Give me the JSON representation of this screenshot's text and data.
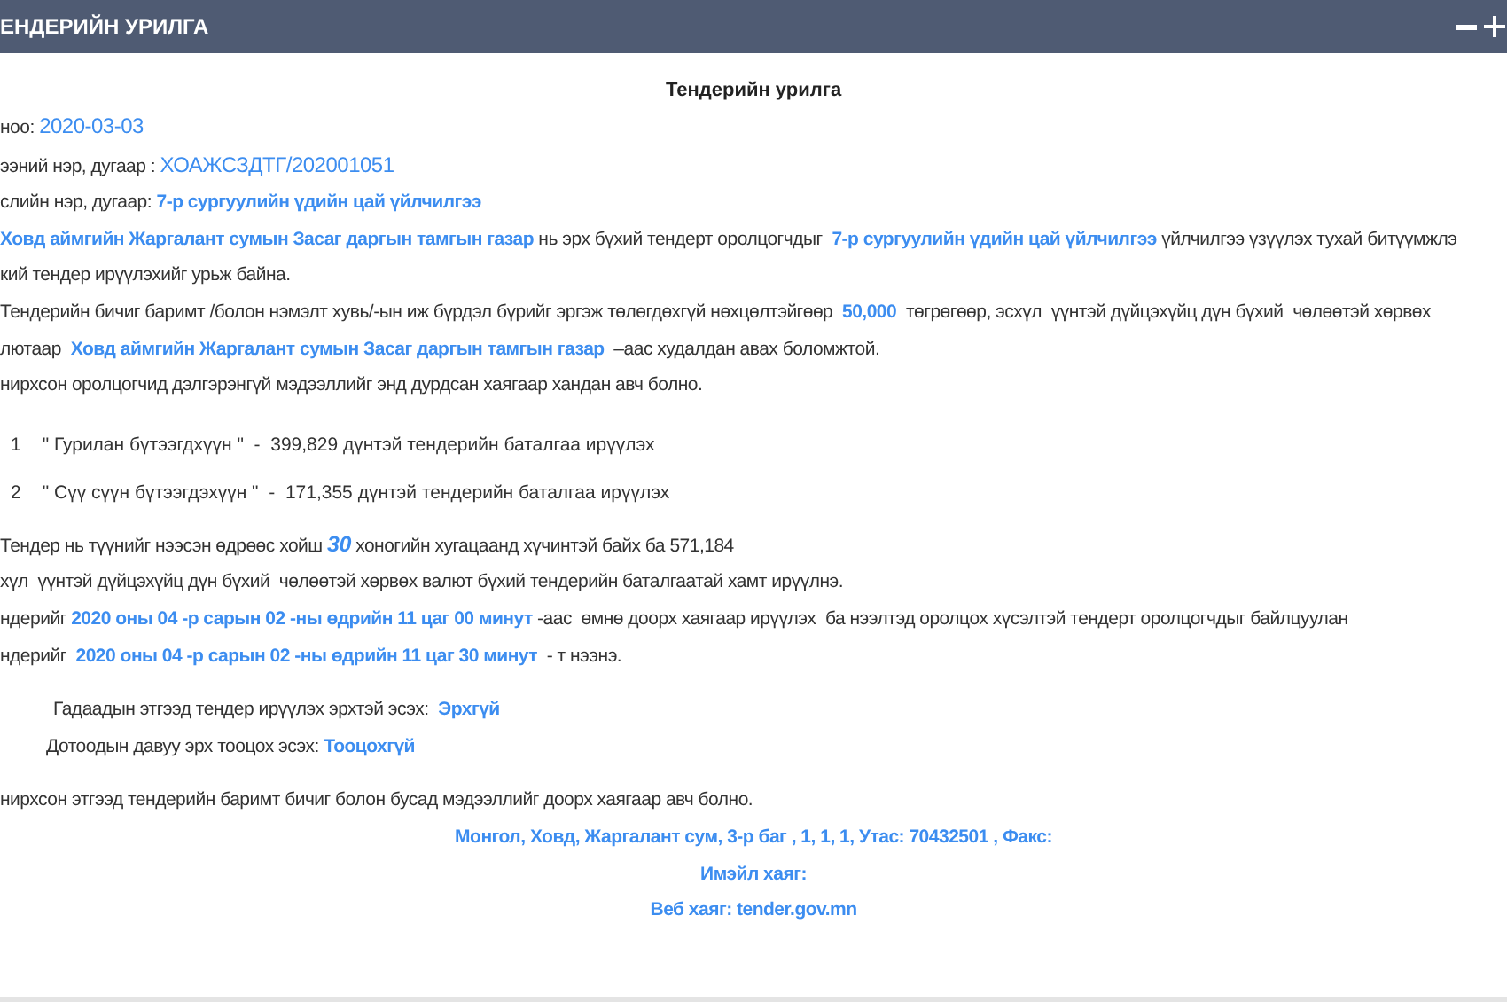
{
  "header": {
    "title": "ЕНДЕРИЙН УРИЛГА"
  },
  "document": {
    "title": "Тендерийн урилга",
    "intro": [
      {
        "kind": "text",
        "segments": [
          {
            "kind": "plain",
            "text": "ноо: "
          },
          {
            "kind": "value",
            "text": "2020-03-03"
          }
        ]
      },
      {
        "kind": "text",
        "segments": [
          {
            "kind": "plain",
            "text": "ээний нэр, дугаар : "
          },
          {
            "kind": "value",
            "text": "ХОАЖСЗДТГ/202001051"
          }
        ]
      },
      {
        "kind": "text",
        "segments": [
          {
            "kind": "plain",
            "text": "слийн нэр, дугаар: "
          },
          {
            "kind": "emph",
            "text": "7-р сургуулийн үдийн цай үйлчилгээ"
          }
        ]
      },
      {
        "kind": "text",
        "segments": [
          {
            "kind": "emph",
            "text": "Ховд аймгийн Жаргалант сумын Засаг даргын тамгын газар"
          },
          {
            "kind": "plain",
            "text": " нь эрх бүхий тендерт оролцогчдыг  "
          },
          {
            "kind": "emph",
            "text": "7-р сургуулийн үдийн цай үйлчилгээ"
          },
          {
            "kind": "plain",
            "text": " үйлчилгээ үзүүлэх тухай битүүмжлэ"
          }
        ]
      },
      {
        "kind": "text",
        "segments": [
          {
            "kind": "plain",
            "text": "кий тендер ирүүлэхийг урьж байна."
          }
        ]
      },
      {
        "kind": "text",
        "segments": [
          {
            "kind": "plain",
            "text": "Тендерийн бичиг баримт /болон нэмэлт хувь/-ын иж бүрдэл бүрийг эргэж төлөгдөхгүй нөхцөлтэйгөөр  "
          },
          {
            "kind": "emph",
            "text": "50,000"
          },
          {
            "kind": "plain",
            "text": "  төгрөгөөр, эсхүл  үүнтэй дүйцэхүйц дүн бүхий  чөлөөтэй хөрвөх"
          }
        ]
      },
      {
        "kind": "text",
        "segments": [
          {
            "kind": "plain",
            "text": "лютаар  "
          },
          {
            "kind": "emph",
            "text": "Ховд аймгийн Жаргалант сумын Засаг даргын тамгын газар"
          },
          {
            "kind": "plain",
            "text": "  –аас худалдан авах боломжтой."
          }
        ]
      },
      {
        "kind": "text",
        "segments": [
          {
            "kind": "plain",
            "text": "нирхсон оролцогчид дэлгэрэнгүй мэдээллийг энд дурдсан хаягаар хандан авч болно."
          }
        ]
      }
    ],
    "items": [
      {
        "number": "1",
        "text": "\" Гурилан бүтээгдхүүн \"  -  399,829 дүнтэй тендерийн баталгаа ирүүлэх"
      },
      {
        "number": "2",
        "text": "\" Сүү сүүн бүтээгдэхүүн \"  -  171,355 дүнтэй тендерийн баталгаа ирүүлэх"
      }
    ],
    "terms": [
      {
        "kind": "text",
        "segments": [
          {
            "kind": "plain",
            "text": "Тендер нь түүнийг нээсэн өдрөөс хойш "
          },
          {
            "kind": "number",
            "text": "30"
          },
          {
            "kind": "plain",
            "text": " хоногийн хугацаанд хүчинтэй байх ба 571,184"
          }
        ]
      },
      {
        "kind": "text",
        "segments": [
          {
            "kind": "plain",
            "text": "хүл  үүнтэй дүйцэхүйц дүн бүхий  чөлөөтэй хөрвөх валют бүхий тендерийн баталгаатай хамт ирүүлнэ."
          }
        ]
      },
      {
        "kind": "text",
        "segments": [
          {
            "kind": "plain",
            "text": "ндерийг "
          },
          {
            "kind": "emph",
            "text": "2020 оны 04 -р сарын 02 -ны өдрийн 11 цаг 00 минут"
          },
          {
            "kind": "plain",
            "text": " -аас  өмнө доорх хаягаар ирүүлэх  ба нээлтэд оролцох хүсэлтэй тендерт оролцогчдыг байлцуулан"
          }
        ]
      },
      {
        "kind": "text",
        "segments": [
          {
            "kind": "plain",
            "text": "ндерийг  "
          },
          {
            "kind": "emph",
            "text": "2020 оны 04 -р сарын 02 -ны өдрийн 11 цаг 30 минут"
          },
          {
            "kind": "plain",
            "text": "  - т нээнэ."
          }
        ]
      }
    ],
    "conditions": [
      {
        "kind": "indent",
        "segments": [
          {
            "kind": "plain",
            "text": "Гадаадын этгээд тендер ирүүлэх эрхтэй эсэх:  "
          },
          {
            "kind": "emph",
            "text": "Эрхгүй"
          }
        ]
      },
      {
        "kind": "indent",
        "segments": [
          {
            "kind": "plain",
            "text": "Дотоодын давуу эрх тооцох эсэх: "
          },
          {
            "kind": "emph",
            "text": "Тооцохгүй"
          }
        ]
      }
    ],
    "contact": [
      {
        "kind": "text",
        "segments": [
          {
            "kind": "plain",
            "text": "нирхсон этгээд тендерийн баримт бичиг болон бусад мэдээллийг доорх хаягаар авч болно."
          }
        ]
      },
      {
        "kind": "center",
        "segments": [
          {
            "kind": "emph",
            "text": "Монгол, Ховд, Жаргалант сум, 3-р баг , 1, 1, 1, Утас: 70432501 , Факс:"
          }
        ]
      },
      {
        "kind": "center",
        "segments": [
          {
            "kind": "emph",
            "text": "Имэйл хаяг:"
          }
        ]
      },
      {
        "kind": "center",
        "segments": [
          {
            "kind": "emph",
            "text": "Веб хаяг: tender.gov.mn"
          }
        ]
      }
    ]
  }
}
